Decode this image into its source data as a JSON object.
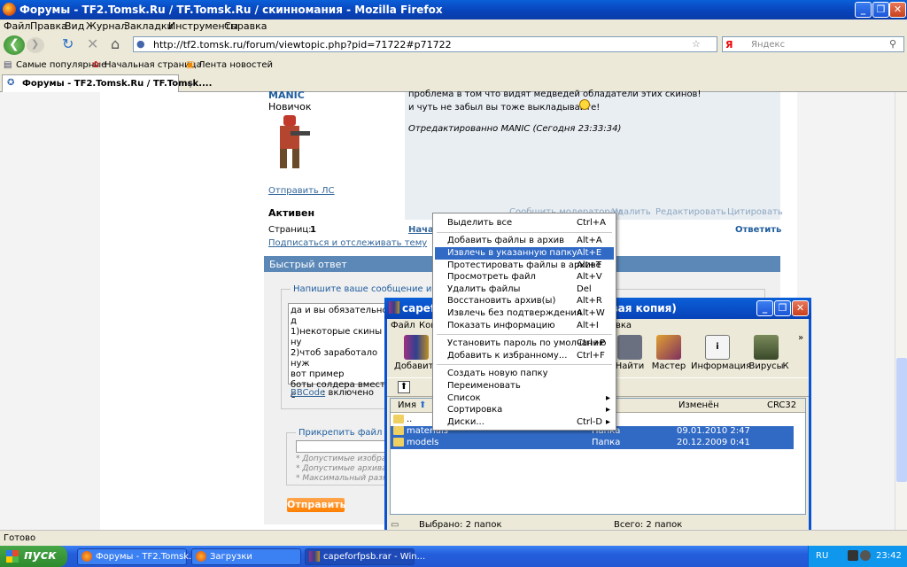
{
  "browser": {
    "title": "Форумы - TF2.Tomsk.Ru / TF.Tomsk.Ru / скинномания - Mozilla Firefox",
    "menu": [
      "Файл",
      "Правка",
      "Вид",
      "Журнал",
      "Закладки",
      "Инструменты",
      "Справка"
    ],
    "url": "http://tf2.tomsk.ru/forum/viewtopic.php?pid=71722#p71722",
    "search_placeholder": "Яндекс",
    "bookmarks": [
      "Самые популярные",
      "Начальная страница",
      "Лента новостей"
    ],
    "tab_label": "Форумы - TF2.Tomsk.Ru / TF.Tomsk....",
    "status": "Готово"
  },
  "post": {
    "author": "MANIC",
    "rank": "Новичок",
    "pm_link": "Отправить ЛС",
    "status": "Активен",
    "text1": "проблема в том что видят медведей обладатели этих скинов!",
    "text2": "и чуть не забыл вы тоже выкладывайте!",
    "edited": "Отредактированно MANIC (Сегодня 23:33:34)",
    "actions": [
      "Сообщить модераторам",
      "Удалить",
      "Редактировать",
      "Цитировать"
    ]
  },
  "pager": {
    "label": "Страниц:",
    "current": "1",
    "start": "Нача",
    "subscribe": "Подписаться и отслеживать тему",
    "reply": "Ответить"
  },
  "fast_reply": {
    "header": "Быстрый ответ",
    "legend": "Напишите ваше сообщение и наж",
    "lines": [
      "да и вы обязательно д",
      "1)некоторые скины ну",
      "2)чтоб заработало нуж",
      "вот пример",
      "боты солдера вмести с"
    ],
    "bbcode": "BBCode",
    "bbcode_state": ": включено",
    "attach_legend": "Прикрепить файл",
    "hints": [
      "* Допустимые изобра",
      "* Допустимые архива",
      "* Максимальный разм"
    ],
    "send": "Отправить"
  },
  "context_menu": {
    "items": [
      {
        "label": "Выделить все",
        "shortcut": "Ctrl+A"
      },
      {
        "label": "Добавить файлы в архив",
        "shortcut": "Alt+A"
      },
      {
        "label": "Извлечь в указанную папку",
        "shortcut": "Alt+E",
        "highlighted": true
      },
      {
        "label": "Протестировать файлы в архиве",
        "shortcut": "Alt+T"
      },
      {
        "label": "Просмотреть файл",
        "shortcut": "Alt+V"
      },
      {
        "label": "Удалить файлы",
        "shortcut": "Del"
      },
      {
        "label": "Восстановить архив(ы)",
        "shortcut": "Alt+R"
      },
      {
        "label": "Извлечь без подтверждения",
        "shortcut": "Alt+W"
      },
      {
        "label": "Показать информацию",
        "shortcut": "Alt+I"
      },
      {
        "label": "Установить пароль по умолчанию",
        "shortcut": "Ctrl+P"
      },
      {
        "label": "Добавить к избранному...",
        "shortcut": "Ctrl+F"
      },
      {
        "label": "Создать новую папку",
        "shortcut": ""
      },
      {
        "label": "Переименовать",
        "shortcut": ""
      },
      {
        "label": "Список",
        "shortcut": ""
      },
      {
        "label": "Сортировка",
        "shortcut": ""
      },
      {
        "label": "Диски...",
        "shortcut": "Ctrl-D"
      }
    ]
  },
  "winrar": {
    "title_left": "capefo",
    "title_right": "вая копия)",
    "menu": [
      "Файл",
      "Кома",
      "вка"
    ],
    "tools": [
      "Добавить",
      "Найти",
      "Мастер",
      "Информация",
      "Вирусы",
      "К"
    ],
    "columns": [
      "Имя",
      "Изменён",
      "CRC32"
    ],
    "rows": [
      {
        "name": "..",
        "type": "",
        "date": ""
      },
      {
        "name": "materials",
        "type": "Папка",
        "date": "09.01.2010 2:47"
      },
      {
        "name": "models",
        "type": "Папка",
        "date": "20.12.2009 0:41"
      }
    ],
    "status_left": "Выбрано: 2 папок",
    "status_right": "Всего: 2 папок"
  },
  "taskbar": {
    "start": "пуск",
    "items": [
      "Форумы - TF2.Tomsk....",
      "Загрузки",
      "capeforfpsb.rar - Win..."
    ],
    "lang": "RU",
    "time": "23:42"
  }
}
